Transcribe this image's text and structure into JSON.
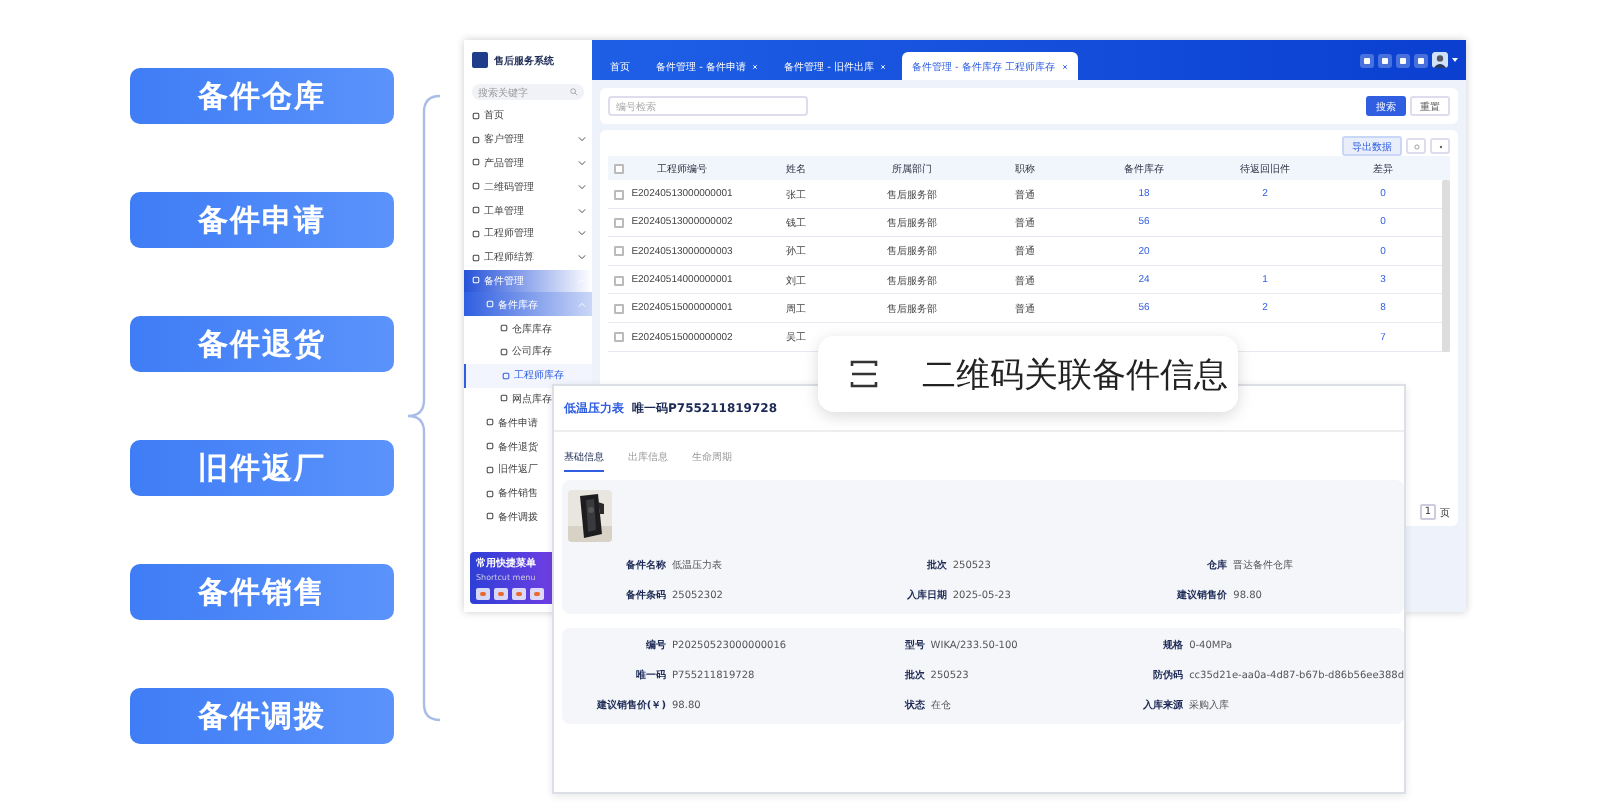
{
  "features": [
    {
      "label": "备件仓库"
    },
    {
      "label": "备件申请"
    },
    {
      "label": "备件退货"
    },
    {
      "label": "旧件返厂"
    },
    {
      "label": "备件销售"
    },
    {
      "label": "备件调拨"
    }
  ],
  "app": {
    "title": "售后服务系统",
    "sidebar_search": {
      "placeholder": "搜索关键字"
    },
    "sidebar": [
      {
        "label": "首页",
        "selected": false
      },
      {
        "label": "客户管理",
        "selected": false,
        "expanded": false
      },
      {
        "label": "产品管理",
        "selected": false,
        "expanded": false
      },
      {
        "label": "二维码管理",
        "selected": false,
        "expanded": false
      },
      {
        "label": "工单管理",
        "selected": false,
        "expanded": false
      },
      {
        "label": "工程师管理",
        "selected": false,
        "expanded": false
      },
      {
        "label": "工程师结算",
        "selected": false,
        "expanded": false
      },
      {
        "label": "备件管理",
        "selected": false,
        "expanded": true,
        "children": [
          {
            "label": "备件库存",
            "selected": false,
            "expanded": true,
            "children": [
              {
                "label": "仓库库存",
                "selected": false
              },
              {
                "label": "公司库存",
                "selected": false
              },
              {
                "label": "工程师库存",
                "selected": true
              },
              {
                "label": "网点库存",
                "selected": false
              }
            ]
          },
          {
            "label": "备件申请",
            "selected": false
          },
          {
            "label": "备件退货",
            "selected": false
          },
          {
            "label": "旧件返厂",
            "selected": false
          },
          {
            "label": "备件销售",
            "selected": false
          },
          {
            "label": "备件调拨",
            "selected": false
          }
        ]
      }
    ],
    "shortcut": {
      "title": "常用快捷菜单",
      "subtitle": "Shortcut menu"
    },
    "tabs": [
      {
        "label": "首页",
        "closable": false,
        "selected": false
      },
      {
        "label": "备件管理 - 备件申请",
        "closable": true,
        "selected": false
      },
      {
        "label": "备件管理 - 旧件出库",
        "closable": true,
        "selected": false
      },
      {
        "label": "备件管理 - 备件库存 工程师库存",
        "closable": true,
        "selected": true
      }
    ],
    "filter": {
      "placeholder": "编号检索",
      "buttons": [
        {
          "label": "搜索",
          "kind": "primary"
        },
        {
          "label": "重置",
          "kind": "plain"
        }
      ]
    },
    "table": {
      "export_button": "导出数据",
      "all_checked": false,
      "columns": [
        {
          "label": "工程师编号",
          "kind": "text"
        },
        {
          "label": "姓名",
          "kind": "text"
        },
        {
          "label": "所属部门",
          "kind": "text"
        },
        {
          "label": "职称",
          "kind": "text"
        },
        {
          "label": "备件库存",
          "kind": "link"
        },
        {
          "label": "待返回旧件",
          "kind": "link"
        },
        {
          "label": "差异",
          "kind": "link"
        }
      ],
      "rows": [
        {
          "checked": false,
          "cells": [
            "E20240513000000001",
            "张工",
            "售后服务部",
            "普通",
            "18",
            "2",
            "0"
          ]
        },
        {
          "checked": false,
          "cells": [
            "E20240513000000002",
            "钱工",
            "售后服务部",
            "普通",
            "56",
            "",
            "0"
          ]
        },
        {
          "checked": false,
          "cells": [
            "E20240513000000003",
            "孙工",
            "售后服务部",
            "普通",
            "20",
            "",
            "0"
          ]
        },
        {
          "checked": false,
          "cells": [
            "E20240514000000001",
            "刘工",
            "售后服务部",
            "普通",
            "24",
            "1",
            "3"
          ]
        },
        {
          "checked": false,
          "cells": [
            "E20240515000000001",
            "周工",
            "售后服务部",
            "普通",
            "56",
            "2",
            "8"
          ]
        },
        {
          "checked": false,
          "cells": [
            "E20240515000000002",
            "吴工",
            "",
            "",
            "",
            "",
            "7"
          ]
        }
      ],
      "page": "1",
      "page_unit": "页"
    }
  },
  "callout": {
    "text": "二维码关联备件信息"
  },
  "detail": {
    "name": "低温压力表",
    "code": "唯一码P755211819728",
    "tabs": [
      {
        "label": "基础信息",
        "selected": true
      },
      {
        "label": "出库信息",
        "selected": false
      },
      {
        "label": "生命周期",
        "selected": false
      }
    ],
    "basic": [
      {
        "label": "备件名称",
        "value": "低温压力表"
      },
      {
        "label": "批次",
        "value": "250523"
      },
      {
        "label": "仓库",
        "value": "晋达备件仓库"
      },
      {
        "label": "备件条码",
        "value": "25052302"
      },
      {
        "label": "入库日期",
        "value": "2025-05-23"
      },
      {
        "label": "建议销售价",
        "value": "98.80"
      }
    ],
    "specs": [
      {
        "label": "编号",
        "value": "P20250523000000016"
      },
      {
        "label": "型号",
        "value": "WIKA/233.50-100"
      },
      {
        "label": "规格",
        "value": "0-40MPa"
      },
      {
        "label": "唯一码",
        "value": "P755211819728"
      },
      {
        "label": "批次",
        "value": "250523"
      },
      {
        "label": "防伪码",
        "value": "cc35d21e-aa0a-4d87-b67b-d86b56ee388d"
      },
      {
        "label": "建议销售价(￥)",
        "value": "98.80"
      },
      {
        "label": "状态",
        "value": "在仓"
      },
      {
        "label": "入库来源",
        "value": "采购入库"
      }
    ]
  }
}
